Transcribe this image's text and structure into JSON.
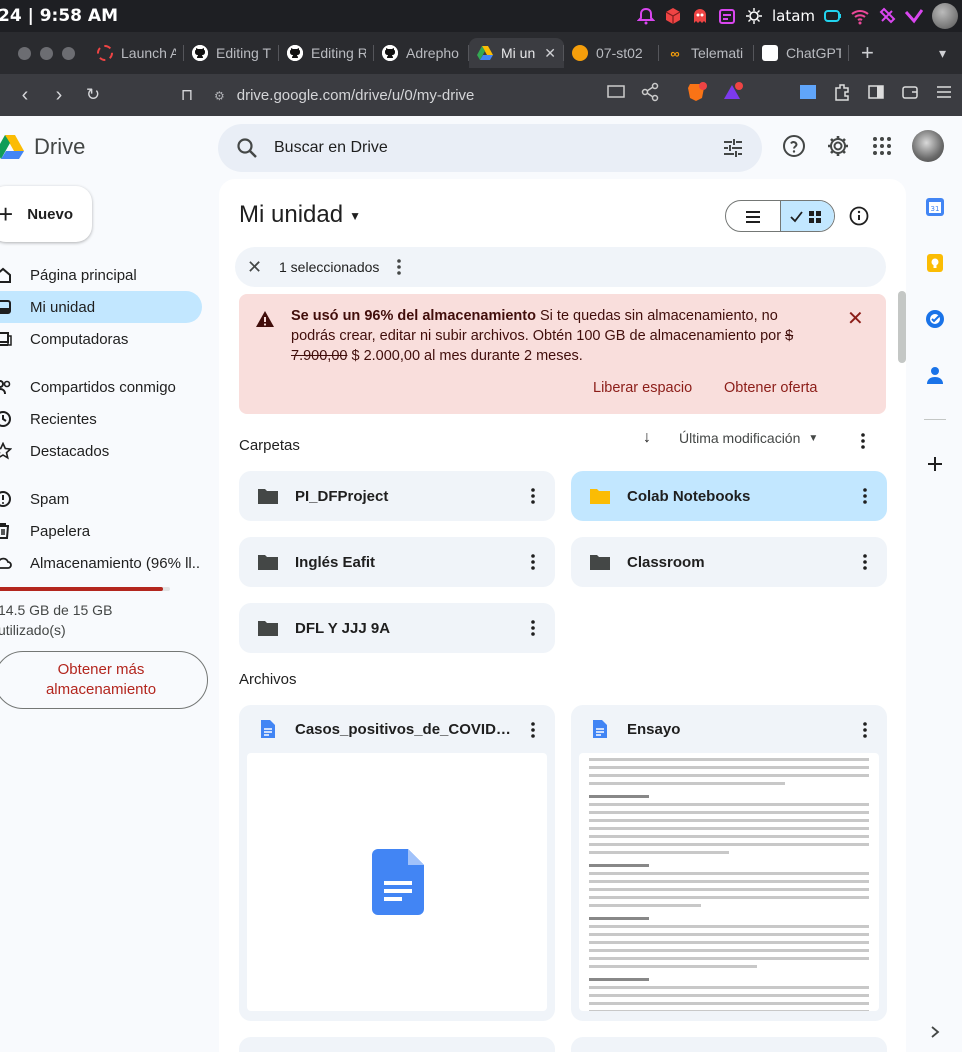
{
  "os": {
    "clock": "24 | 9:58 AM",
    "tray_label": "latam"
  },
  "tabs": [
    {
      "label": "Launch A"
    },
    {
      "label": "Editing T"
    },
    {
      "label": "Editing R"
    },
    {
      "label": "Adrepho"
    },
    {
      "label": "Mi un",
      "active": true
    },
    {
      "label": "07-st02"
    },
    {
      "label": "Telemati"
    },
    {
      "label": "ChatGPT"
    }
  ],
  "address": {
    "url": "drive.google.com/drive/u/0/my-drive",
    "brave_badge": "1",
    "alert_badge": "1"
  },
  "app": {
    "name": "Drive",
    "search_placeholder": "Buscar en Drive"
  },
  "sidebar": {
    "new_label": "Nuevo",
    "items": [
      {
        "label": "Página principal",
        "icon": "home-icon"
      },
      {
        "label": "Mi unidad",
        "icon": "my-drive-icon",
        "active": true
      },
      {
        "label": "Computadoras",
        "icon": "computers-icon"
      },
      {
        "label": "Compartidos conmigo",
        "icon": "shared-icon"
      },
      {
        "label": "Recientes",
        "icon": "clock-icon"
      },
      {
        "label": "Destacados",
        "icon": "star-icon"
      },
      {
        "label": "Spam",
        "icon": "spam-icon"
      },
      {
        "label": "Papelera",
        "icon": "trash-icon"
      },
      {
        "label": "Almacenamiento (96% ll...",
        "icon": "cloud-icon"
      }
    ],
    "storage": {
      "used_fraction": 0.96,
      "line1": "14.5 GB de 15 GB",
      "line2": "utilizado(s)",
      "get_more_line1": "Obtener más",
      "get_more_line2": "almacenamiento"
    }
  },
  "main": {
    "title": "Mi unidad",
    "selection": {
      "count_label": "1 seleccionados"
    },
    "banner": {
      "bold": "Se usó un 96% del almacenamiento",
      "text1": " Si te quedas sin almacenamiento, no podrás crear, editar ni subir archivos. Obtén 100 GB de almacenamiento por ",
      "old_price": "$ 7.900,00",
      "text2": " $ 2.000,00 al mes durante 2 meses.",
      "action1": "Liberar espacio",
      "action2": "Obtener oferta"
    },
    "folders_title": "Carpetas",
    "sort_label": "Última modificación",
    "folders": [
      {
        "name": "PI_DFProject",
        "selected": false
      },
      {
        "name": "Colab Notebooks",
        "selected": true
      },
      {
        "name": "Inglés Eafit",
        "selected": false
      },
      {
        "name": "Classroom",
        "selected": false
      },
      {
        "name": "DFL Y JJJ 9A",
        "selected": false
      }
    ],
    "files_title": "Archivos",
    "files": [
      {
        "name": "Casos_positivos_de_COVID-19...",
        "type": "doc"
      },
      {
        "name": "Ensayo",
        "type": "doc"
      }
    ]
  },
  "colors": {
    "accent": "#0b57d0",
    "selected_bg": "#c2e7ff",
    "warning_bg": "#f9dedc",
    "warning_text": "#8c1d18",
    "storage_fill": "#b3261e"
  }
}
